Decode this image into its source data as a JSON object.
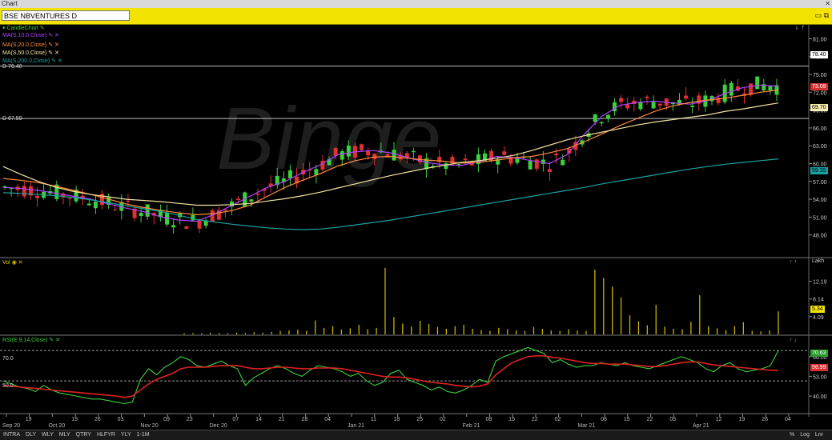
{
  "window": {
    "title": "Chart",
    "close_icon": "close-icon"
  },
  "symbol": {
    "name": "BSE NBVENTURES D"
  },
  "price_panel": {
    "indicators": [
      {
        "label": "CandleChart",
        "color": "#3bd03b"
      },
      {
        "label": "MA(S,10.0,Close)",
        "color": "#b040ff"
      },
      {
        "label": "MA(S,20.0,Close)",
        "color": "#ff8c3a"
      },
      {
        "label": "MA(S,50.0,Close)",
        "color": "#f2e1a0"
      },
      {
        "label": "MA(S,200.0,Close)",
        "color": "#1aa0a0"
      }
    ],
    "ref_line_1": "D 76.40",
    "ref_line_2": "D 67.59",
    "watermark": "Binge",
    "tags": {
      "last": "78.40",
      "ma10": "73.09",
      "ma50": "69.70",
      "ma200": "59.35"
    }
  },
  "vol_panel": {
    "label": "Vol",
    "unit": "Lakh",
    "tag": "5.34"
  },
  "rsi_panel": {
    "label": "RSI(E,9,14,Close)",
    "level_70": "70.0",
    "level_50": "50.0",
    "tag_1": "70.63",
    "tag_2": "56.99"
  },
  "chart_data": [
    {
      "type": "line",
      "title": "BSE NBVENTURES D",
      "y_ticks": [
        81,
        78,
        75,
        72,
        69,
        66,
        63,
        60,
        57,
        54,
        51,
        48
      ],
      "ylim": [
        45,
        82
      ],
      "x_ticks": [
        "Sep 20",
        "19",
        "Oct 20",
        "19",
        "26",
        "03",
        "Nov 20",
        "09",
        "23",
        "Dec 20",
        "07",
        "14",
        "21",
        "28",
        "04",
        "Jan 21",
        "11",
        "18",
        "25",
        "02",
        "Feb 21",
        "08",
        "15",
        "22",
        "02",
        "Mar 21",
        "08",
        "15",
        "22",
        "05",
        "Apr 21",
        "12",
        "19",
        "26",
        "04"
      ],
      "series": [
        {
          "name": "MA(S,10.0,Close)",
          "values": [
            56,
            55.8,
            55.5,
            55,
            54.5,
            54,
            53.2,
            52.5,
            51.9,
            51,
            50.5,
            50.3,
            51.5,
            53,
            54.5,
            56,
            57,
            58.5,
            59.8,
            61.5,
            62,
            62.2,
            61.8,
            61,
            60.2,
            59.8,
            59.7,
            60.3,
            61.2,
            61,
            60.5,
            60,
            61.5,
            65,
            68,
            69.8,
            70.3,
            70.5,
            70.2,
            70,
            70.6,
            71.8,
            72.8,
            73.2,
            73
          ]
        },
        {
          "name": "MA(S,20.0,Close)",
          "values": [
            57.5,
            57.2,
            56.8,
            56.2,
            55.5,
            54.8,
            54,
            53.2,
            52.6,
            52.1,
            51.7,
            51.4,
            51.6,
            52.1,
            53,
            54.5,
            56,
            57.2,
            58.3,
            59.6,
            60.5,
            61.1,
            61.2,
            60.9,
            60.6,
            60.4,
            60.1,
            60.2,
            60.6,
            61,
            61.2,
            61.8,
            62.5,
            63.7,
            65,
            66.4,
            67.6,
            68.8,
            69.7,
            70.3,
            70.7,
            71,
            71.5,
            72,
            72.4
          ]
        },
        {
          "name": "MA(S,50.0,Close)",
          "values": [
            59.5,
            58.2,
            57,
            56,
            55.3,
            54.8,
            54.4,
            54,
            53.8,
            53.6,
            53.3,
            53,
            53,
            53.1,
            53.3,
            53.7,
            54.1,
            54.6,
            55.2,
            55.9,
            56.6,
            57.3,
            58,
            58.6,
            59.2,
            59.7,
            60.2,
            60.5,
            60.9,
            61.4,
            62.2,
            63.1,
            64,
            64.7,
            65.3,
            65.9,
            66.5,
            67,
            67.4,
            67.8,
            68.2,
            68.8,
            69.2,
            69.7,
            70.2
          ]
        },
        {
          "name": "MA(S,200.0,Close)",
          "values": [
            55.1,
            55,
            54.8,
            54.6,
            54.3,
            53.9,
            53.4,
            52.9,
            52.4,
            51.9,
            51.3,
            50.6,
            50.2,
            49.8,
            49.5,
            49.2,
            49,
            48.9,
            49,
            49.3,
            49.7,
            50.1,
            50.5,
            51,
            51.5,
            52,
            52.5,
            53,
            53.5,
            54,
            54.5,
            55,
            55.5,
            56,
            56.6,
            57.1,
            57.6,
            58.1,
            58.6,
            59.1,
            59.5,
            59.9,
            60.2,
            60.5,
            60.8
          ]
        }
      ]
    },
    {
      "type": "bar",
      "title": "Vol",
      "y_ticks": [
        12.19,
        8.14,
        4.09
      ],
      "unit": "Lakh",
      "values": [
        0.3,
        0.3,
        0.3,
        0.4,
        0.3,
        0.3,
        0.4,
        0.3,
        0.5,
        0.4,
        0.6,
        0.8,
        0.9,
        1.1,
        0.8,
        3.2,
        1.5,
        1.9,
        1.1,
        1.4,
        2.2,
        1.2,
        1.5,
        15.3,
        4.0,
        2.5,
        1.8,
        3.1,
        2.4,
        1.7,
        1.3,
        1.9,
        2.2,
        1.3,
        1.0,
        0.8,
        1.5,
        1.2,
        0.9,
        0.8,
        1.7,
        1.3,
        0.9,
        0.8,
        1.2,
        0.9,
        0.8,
        14.9,
        13.0,
        11.0,
        8.5,
        4.4,
        3.0,
        2.1,
        6.8,
        1.8,
        1.3,
        1.2,
        2.9,
        9.0,
        1.9,
        1.4,
        1.0,
        1.9,
        2.8,
        0.8,
        0.7,
        0.9,
        5.3
      ]
    },
    {
      "type": "line",
      "title": "RSI(E,9,14,Close)",
      "y_ticks": [
        66,
        53,
        40
      ],
      "levels": [
        70,
        50
      ],
      "series": [
        {
          "name": "RSI",
          "values": [
            50,
            48,
            46,
            45,
            43,
            47,
            44,
            42,
            41,
            40,
            39,
            38,
            38,
            37,
            36,
            35,
            36,
            51,
            58,
            54,
            59,
            62,
            66,
            64,
            60,
            59,
            61,
            63,
            60,
            58,
            47,
            52,
            55,
            58,
            60,
            58,
            55,
            53,
            57,
            60,
            59,
            58,
            56,
            53,
            55,
            50,
            47,
            49,
            55,
            57,
            51,
            49,
            47,
            44,
            46,
            43,
            42,
            44,
            47,
            51,
            49,
            63,
            66,
            68,
            70,
            72,
            70,
            68,
            62,
            64,
            61,
            59,
            60,
            60,
            62,
            61,
            60,
            62,
            60,
            59,
            58,
            60,
            62,
            64,
            66,
            64,
            62,
            58,
            56,
            60,
            62,
            58,
            56,
            57,
            58,
            60,
            70
          ]
        },
        {
          "name": "Signal",
          "values": [
            47,
            46.5,
            46,
            45.5,
            45,
            44.5,
            44,
            43.5,
            43,
            42.5,
            42,
            41.5,
            41,
            40.5,
            40,
            39,
            40,
            44,
            48,
            51,
            53,
            55,
            58,
            59,
            59,
            59,
            59.5,
            60,
            60,
            60,
            59,
            58,
            58,
            58.5,
            59,
            59,
            58.5,
            58,
            58,
            58.5,
            58.5,
            58.5,
            58,
            57,
            56,
            55,
            54,
            53,
            52.5,
            52.5,
            52,
            51,
            50,
            49,
            48.5,
            48,
            47,
            46.5,
            46,
            46.5,
            48,
            54,
            58,
            62,
            64,
            66,
            66.5,
            66.5,
            65.5,
            65,
            64,
            63,
            62,
            61.5,
            61.5,
            61,
            61,
            61,
            60.5,
            60,
            59.5,
            59.5,
            60,
            61,
            62,
            62.5,
            62.5,
            61.5,
            60.5,
            60,
            59.5,
            59,
            58.5,
            58,
            57.5,
            57,
            57
          ]
        }
      ]
    }
  ],
  "timeframes": [
    "INTRA",
    "DLY",
    "WLY",
    "MLY",
    "QTRY",
    "HLFYR",
    "YLY",
    "1-1M"
  ],
  "bottom_right": [
    "%",
    "Log",
    "Lnr"
  ]
}
